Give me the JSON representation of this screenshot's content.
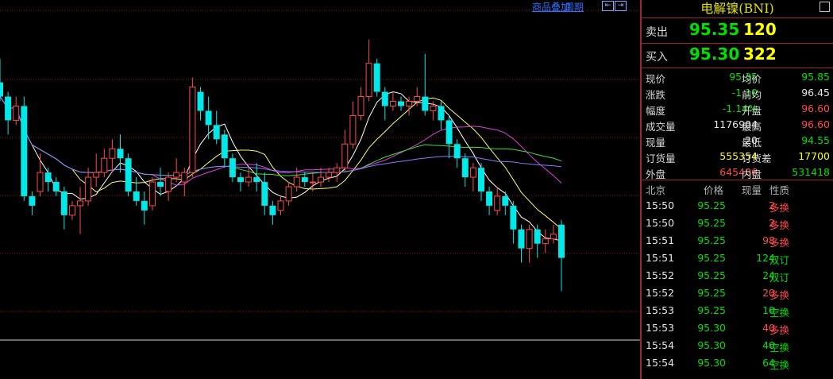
{
  "toolbar": {
    "overlay_label": "商品叠加",
    "period_label": "周期",
    "nav": [
      "⇤",
      "⇥"
    ]
  },
  "panel": {
    "title": "电解镍(BNI)",
    "sell": {
      "label": "卖出",
      "price": "95.35",
      "volume": "120"
    },
    "buy": {
      "label": "买入",
      "price": "95.30",
      "volume": "322"
    },
    "stats": [
      {
        "k1": "现价",
        "v1": "95.35",
        "c1": "green",
        "k2": "均价",
        "v2": "95.85",
        "c2": "green"
      },
      {
        "k1": "涨跌",
        "v1": "-1.10",
        "c1": "green",
        "k2": "前均",
        "v2": "96.45",
        "c2": "white"
      },
      {
        "k1": "幅度",
        "v1": "-1.14%",
        "c1": "green",
        "k2": "开盘",
        "v2": "96.60",
        "c2": "red"
      },
      {
        "k1": "成交量",
        "v1": "1176904",
        "c1": "white",
        "k2": "最高",
        "v2": "96.60",
        "c2": "red"
      },
      {
        "k1": "现量",
        "v1": "20",
        "c1": "white",
        "k2": "最低",
        "v2": "94.55",
        "c2": "green"
      },
      {
        "k1": "订货量",
        "v1": "555354",
        "c1": "yellow",
        "k2": "订货差",
        "v2": "17700",
        "c2": "yellow"
      },
      {
        "k1": "外盘",
        "v1": "645486",
        "c1": "red",
        "k2": "内盘",
        "v2": "531418",
        "c2": "green"
      }
    ],
    "ticks_header": {
      "time": "北京",
      "price": "价格",
      "volume": "现量",
      "type": "性质"
    },
    "ticks": [
      {
        "time": "15:50",
        "price": "95.25",
        "volume": "2",
        "vc": "red",
        "type": "多换",
        "tc": "red"
      },
      {
        "time": "15:50",
        "price": "95.25",
        "volume": "2",
        "vc": "red",
        "type": "多换",
        "tc": "red"
      },
      {
        "time": "15:51",
        "price": "95.25",
        "volume": "98",
        "vc": "red",
        "type": "多换",
        "tc": "red"
      },
      {
        "time": "15:51",
        "price": "95.25",
        "volume": "124",
        "vc": "green",
        "type": "双订",
        "tc": "green"
      },
      {
        "time": "15:52",
        "price": "95.25",
        "volume": "24",
        "vc": "green",
        "type": "双订",
        "tc": "green"
      },
      {
        "time": "15:52",
        "price": "95.25",
        "volume": "20",
        "vc": "red",
        "type": "多换",
        "tc": "red"
      },
      {
        "time": "15:53",
        "price": "95.25",
        "volume": "10",
        "vc": "green",
        "type": "空换",
        "tc": "green"
      },
      {
        "time": "15:53",
        "price": "95.30",
        "volume": "40",
        "vc": "red",
        "type": "多换",
        "tc": "red"
      },
      {
        "time": "15:54",
        "price": "95.30",
        "volume": "40",
        "vc": "green",
        "type": "空换",
        "tc": "green"
      },
      {
        "time": "15:54",
        "price": "95.30",
        "volume": "64",
        "vc": "green",
        "type": "空换",
        "tc": "green"
      }
    ]
  },
  "colors": {
    "up": "#ff4a4a",
    "down": "#00e8e8",
    "ma5": "#ffffff",
    "ma10": "#ffff66",
    "ma20": "#e040e0",
    "ma30": "#40e040",
    "ma60": "#8080ff",
    "grid": "#8a1c1c"
  },
  "chart_data": {
    "type": "candlestick",
    "y_range_approx": [
      94.2,
      97.8
    ],
    "candles": [
      {
        "o": 97.1,
        "c": 96.95,
        "h": 97.35,
        "l": 96.9
      },
      {
        "o": 96.95,
        "c": 96.7,
        "h": 97.0,
        "l": 96.55
      },
      {
        "o": 96.7,
        "c": 96.85,
        "h": 96.95,
        "l": 96.65
      },
      {
        "o": 96.85,
        "c": 95.9,
        "h": 96.95,
        "l": 95.85
      },
      {
        "o": 95.9,
        "c": 95.8,
        "h": 95.95,
        "l": 95.7
      },
      {
        "o": 95.95,
        "c": 96.15,
        "h": 96.35,
        "l": 95.9
      },
      {
        "o": 96.15,
        "c": 96.05,
        "h": 96.2,
        "l": 95.95
      },
      {
        "o": 96.05,
        "c": 95.95,
        "h": 96.1,
        "l": 95.9
      },
      {
        "o": 95.95,
        "c": 95.7,
        "h": 96.0,
        "l": 95.55
      },
      {
        "o": 95.7,
        "c": 95.8,
        "h": 95.85,
        "l": 95.65
      },
      {
        "o": 95.8,
        "c": 95.85,
        "h": 96.0,
        "l": 95.5
      },
      {
        "o": 95.85,
        "c": 96.1,
        "h": 96.2,
        "l": 95.8
      },
      {
        "o": 96.1,
        "c": 96.15,
        "h": 96.35,
        "l": 96.0
      },
      {
        "o": 96.15,
        "c": 96.3,
        "h": 96.4,
        "l": 96.1
      },
      {
        "o": 96.3,
        "c": 96.4,
        "h": 96.5,
        "l": 96.15
      },
      {
        "o": 96.4,
        "c": 96.3,
        "h": 96.55,
        "l": 96.15
      },
      {
        "o": 96.3,
        "c": 95.95,
        "h": 96.35,
        "l": 95.9
      },
      {
        "o": 95.95,
        "c": 95.85,
        "h": 96.1,
        "l": 95.8
      },
      {
        "o": 95.85,
        "c": 95.75,
        "h": 95.95,
        "l": 95.6
      },
      {
        "o": 95.8,
        "c": 96.05,
        "h": 96.1,
        "l": 95.75
      },
      {
        "o": 96.05,
        "c": 96.0,
        "h": 96.2,
        "l": 95.9
      },
      {
        "o": 95.95,
        "c": 96.1,
        "h": 96.15,
        "l": 95.85
      },
      {
        "o": 96.1,
        "c": 96.15,
        "h": 96.3,
        "l": 96.05
      },
      {
        "o": 96.05,
        "c": 96.15,
        "h": 96.2,
        "l": 95.9
      },
      {
        "o": 96.15,
        "c": 97.05,
        "h": 97.15,
        "l": 96.1
      },
      {
        "o": 97.0,
        "c": 96.8,
        "h": 97.05,
        "l": 96.7
      },
      {
        "o": 96.8,
        "c": 96.65,
        "h": 96.95,
        "l": 96.5
      },
      {
        "o": 96.65,
        "c": 96.5,
        "h": 96.8,
        "l": 96.45
      },
      {
        "o": 96.55,
        "c": 96.3,
        "h": 96.6,
        "l": 96.2
      },
      {
        "o": 96.3,
        "c": 96.1,
        "h": 96.35,
        "l": 96.05
      },
      {
        "o": 96.1,
        "c": 96.05,
        "h": 96.15,
        "l": 95.95
      },
      {
        "o": 96.05,
        "c": 96.1,
        "h": 96.2,
        "l": 96.0
      },
      {
        "o": 96.1,
        "c": 96.05,
        "h": 96.25,
        "l": 95.95
      },
      {
        "o": 96.05,
        "c": 95.8,
        "h": 96.15,
        "l": 95.7
      },
      {
        "o": 95.8,
        "c": 95.7,
        "h": 95.85,
        "l": 95.6
      },
      {
        "o": 95.75,
        "c": 95.85,
        "h": 95.9,
        "l": 95.7
      },
      {
        "o": 95.85,
        "c": 96.0,
        "h": 96.05,
        "l": 95.8
      },
      {
        "o": 96.0,
        "c": 96.1,
        "h": 96.2,
        "l": 95.95
      },
      {
        "o": 96.1,
        "c": 96.05,
        "h": 96.15,
        "l": 96.0
      },
      {
        "o": 96.05,
        "c": 96.05,
        "h": 96.15,
        "l": 95.95
      },
      {
        "o": 96.05,
        "c": 96.1,
        "h": 96.2,
        "l": 96.0
      },
      {
        "o": 96.1,
        "c": 96.15,
        "h": 96.2,
        "l": 96.05
      },
      {
        "o": 96.15,
        "c": 96.2,
        "h": 96.25,
        "l": 96.05
      },
      {
        "o": 96.2,
        "c": 96.45,
        "h": 96.6,
        "l": 96.15
      },
      {
        "o": 96.45,
        "c": 96.75,
        "h": 96.9,
        "l": 96.4
      },
      {
        "o": 96.75,
        "c": 96.95,
        "h": 97.05,
        "l": 96.7
      },
      {
        "o": 96.95,
        "c": 97.3,
        "h": 97.55,
        "l": 96.9
      },
      {
        "o": 97.3,
        "c": 97.0,
        "h": 97.35,
        "l": 96.95
      },
      {
        "o": 97.0,
        "c": 96.85,
        "h": 97.05,
        "l": 96.7
      },
      {
        "o": 96.85,
        "c": 96.9,
        "h": 97.0,
        "l": 96.8
      },
      {
        "o": 96.9,
        "c": 96.85,
        "h": 96.95,
        "l": 96.8
      },
      {
        "o": 96.85,
        "c": 96.9,
        "h": 96.95,
        "l": 96.75
      },
      {
        "o": 96.9,
        "c": 96.95,
        "h": 97.05,
        "l": 96.85
      },
      {
        "o": 96.95,
        "c": 96.8,
        "h": 97.4,
        "l": 96.75
      },
      {
        "o": 96.8,
        "c": 96.85,
        "h": 96.9,
        "l": 96.7
      },
      {
        "o": 96.85,
        "c": 96.7,
        "h": 96.9,
        "l": 96.6
      },
      {
        "o": 96.7,
        "c": 96.45,
        "h": 96.75,
        "l": 96.3
      },
      {
        "o": 96.45,
        "c": 96.3,
        "h": 96.5,
        "l": 96.2
      },
      {
        "o": 96.3,
        "c": 96.1,
        "h": 96.35,
        "l": 96.0
      },
      {
        "o": 96.1,
        "c": 96.2,
        "h": 96.25,
        "l": 95.95
      },
      {
        "o": 96.2,
        "c": 95.95,
        "h": 96.25,
        "l": 95.85
      },
      {
        "o": 95.95,
        "c": 95.8,
        "h": 96.0,
        "l": 95.7
      },
      {
        "o": 95.75,
        "c": 95.9,
        "h": 96.0,
        "l": 95.7
      },
      {
        "o": 95.9,
        "c": 95.8,
        "h": 95.95,
        "l": 95.7
      },
      {
        "o": 95.8,
        "c": 95.55,
        "h": 95.85,
        "l": 95.4
      },
      {
        "o": 95.55,
        "c": 95.35,
        "h": 95.6,
        "l": 95.2
      },
      {
        "o": 95.35,
        "c": 95.55,
        "h": 95.6,
        "l": 95.2
      },
      {
        "o": 95.55,
        "c": 95.4,
        "h": 95.6,
        "l": 95.25
      },
      {
        "o": 95.4,
        "c": 95.45,
        "h": 95.55,
        "l": 95.3
      },
      {
        "o": 95.45,
        "c": 95.5,
        "h": 95.6,
        "l": 95.4
      },
      {
        "o": 95.6,
        "c": 95.25,
        "h": 95.65,
        "l": 94.9
      }
    ]
  }
}
